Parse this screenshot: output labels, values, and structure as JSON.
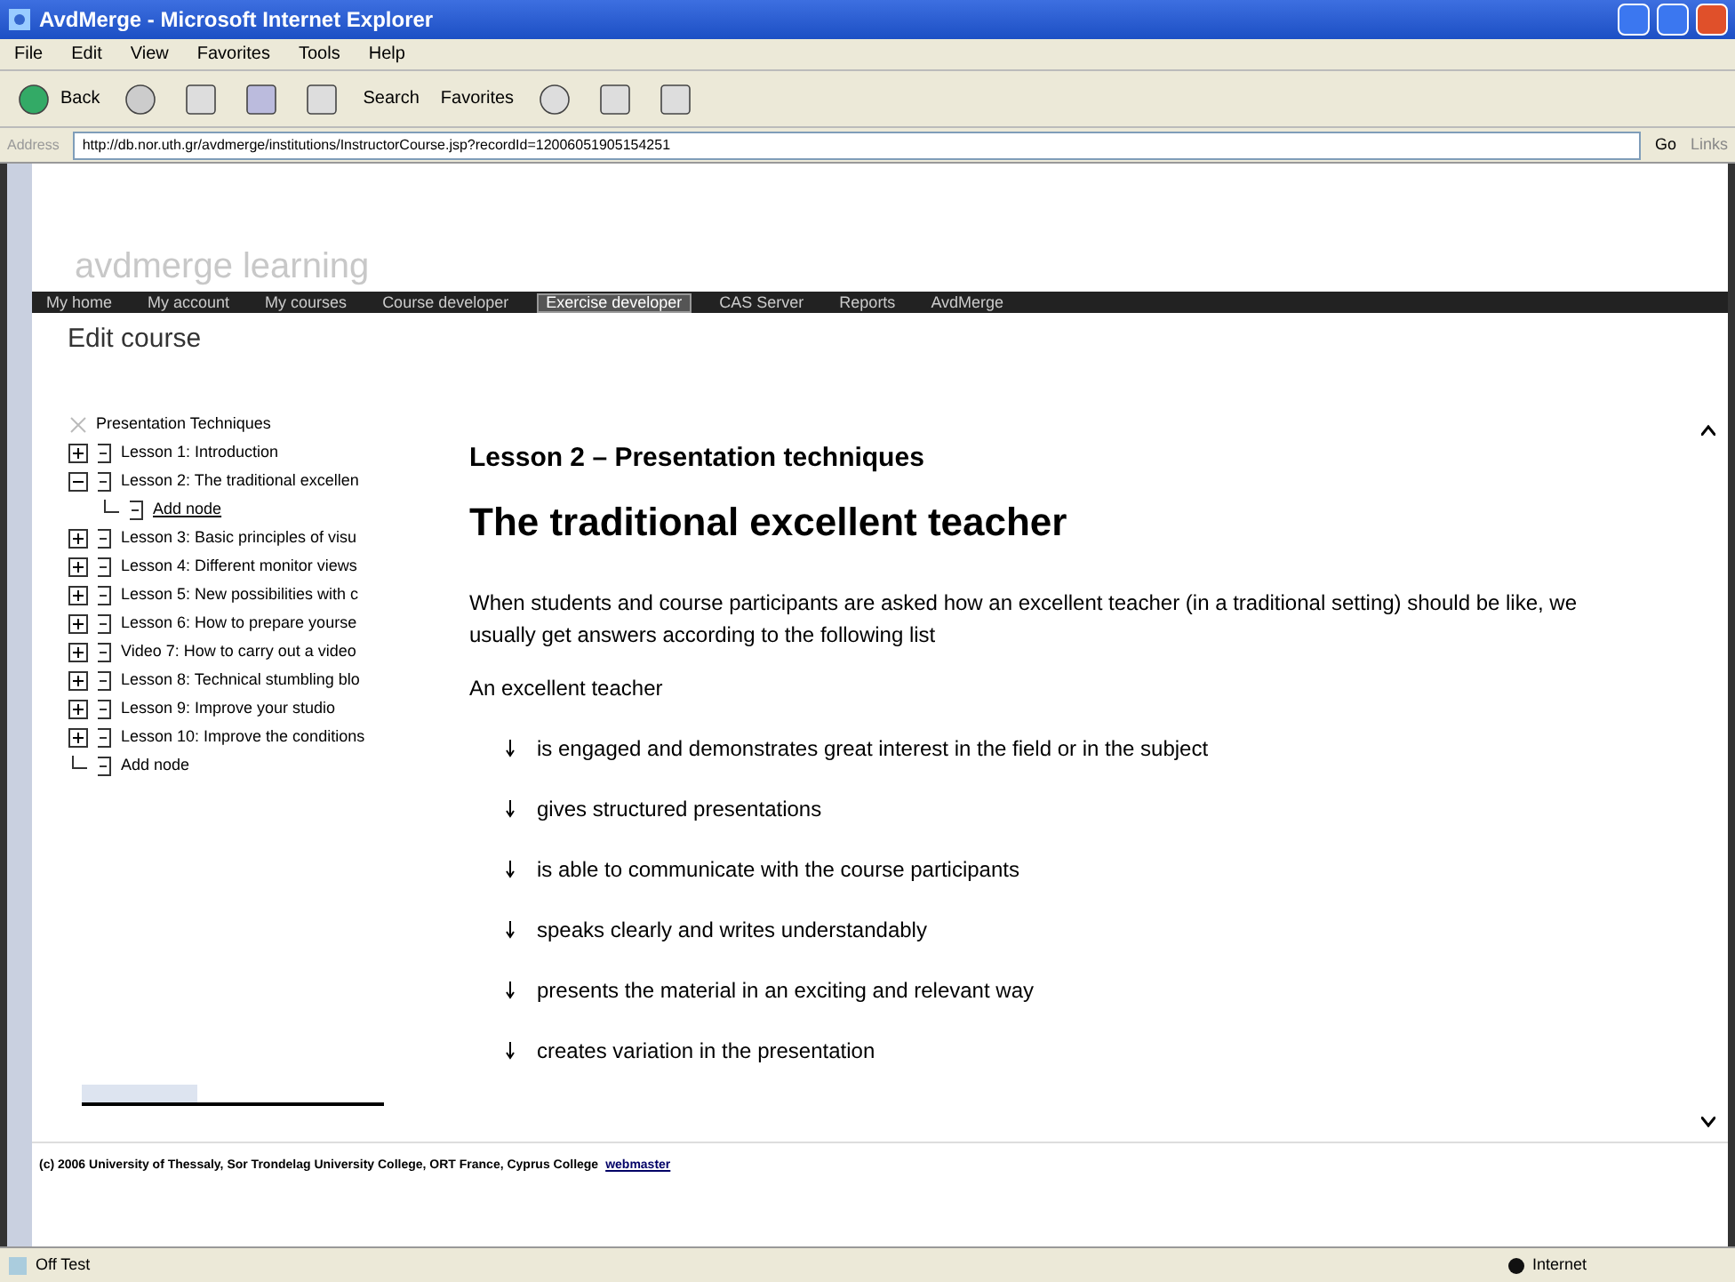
{
  "window": {
    "title": "AvdMerge - Microsoft Internet Explorer"
  },
  "menu": [
    "File",
    "Edit",
    "View",
    "Favorites",
    "Tools",
    "Help"
  ],
  "toolbar": {
    "back": "Back",
    "search": "Search",
    "favorites": "Favorites"
  },
  "address": {
    "label": "Address",
    "value": "http://db.nor.uth.gr/avdmerge/institutions/InstructorCourse.jsp?recordId=12006051905154251",
    "go": "Go",
    "links": "Links"
  },
  "site": {
    "logo": "avdmerge learning"
  },
  "nav": [
    {
      "label": "My home",
      "selected": false
    },
    {
      "label": "My account",
      "selected": false
    },
    {
      "label": "My courses",
      "selected": false
    },
    {
      "label": "Course developer",
      "selected": false
    },
    {
      "label": "Exercise developer",
      "selected": true
    },
    {
      "label": "CAS Server",
      "selected": false
    },
    {
      "label": "Reports",
      "selected": false
    },
    {
      "label": "AvdMerge",
      "selected": false
    }
  ],
  "page_title": "Edit course",
  "tree": {
    "root": "Presentation Techniques",
    "items": [
      {
        "label": "Lesson 1: Introduction",
        "expanded": false
      },
      {
        "label": "Lesson 2: The traditional excellen",
        "expanded": true,
        "children": [
          {
            "label": "Add node"
          }
        ]
      },
      {
        "label": "Lesson 3: Basic principles of visu",
        "expanded": false
      },
      {
        "label": "Lesson 4: Different monitor views",
        "expanded": false
      },
      {
        "label": "Lesson 5: New possibilities with c",
        "expanded": false
      },
      {
        "label": "Lesson 6: How to prepare yourse",
        "expanded": false
      },
      {
        "label": "Video 7: How to carry out a video",
        "expanded": false
      },
      {
        "label": "Lesson 8: Technical stumbling blo",
        "expanded": false
      },
      {
        "label": "Lesson 9: Improve your studio",
        "expanded": false
      },
      {
        "label": "Lesson 10: Improve the conditions",
        "expanded": false
      },
      {
        "label": "Add node"
      }
    ],
    "slider": {
      "level": 0.38
    }
  },
  "content": {
    "subtitle": "Lesson 2 – Presentation techniques",
    "heading": "The traditional excellent teacher",
    "intro": "When students and course participants are asked how an excellent teacher (in a traditional setting) should be like, we usually get answers according to the following list",
    "lead": "An excellent teacher",
    "bullets": [
      "is engaged and demonstrates great interest in the field or in the subject",
      "gives structured presentations",
      "is able to communicate with the course participants",
      "speaks clearly and writes understandably",
      "presents the material in an exciting and relevant way",
      "creates variation in the presentation"
    ]
  },
  "footer": {
    "text": "(c) 2006 University of Thessaly, Sor Trondelag University College, ORT France, Cyprus College",
    "link": "webmaster"
  },
  "status_bar": {
    "text": "Off Test",
    "zone": "Internet"
  }
}
